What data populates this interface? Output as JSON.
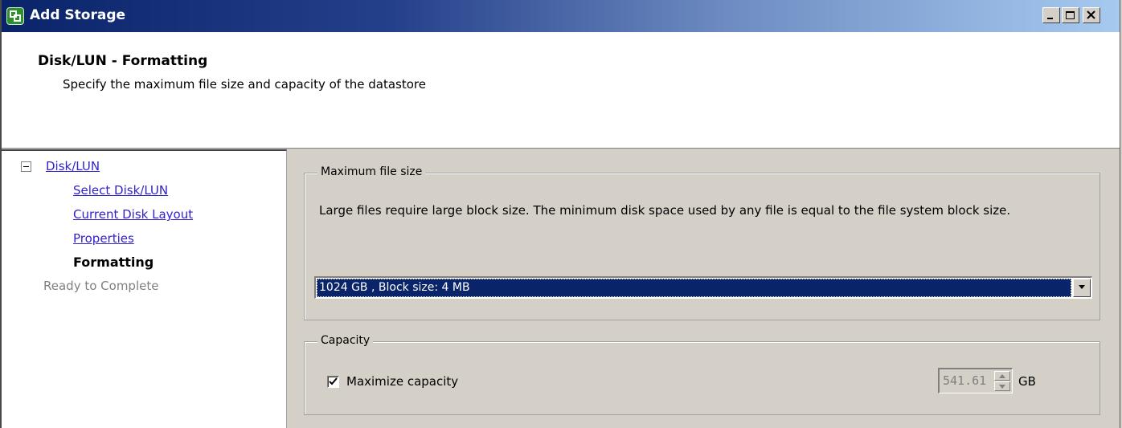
{
  "window": {
    "title": "Add Storage",
    "icon": "vmware-storage-icon",
    "controls": [
      "minimize-icon",
      "maximize-icon",
      "close-icon"
    ]
  },
  "header": {
    "title": "Disk/LUN - Formatting",
    "subtitle": "Specify the maximum file size and capacity of the datastore"
  },
  "nav": {
    "root": "Disk/LUN",
    "items": [
      {
        "label": "Select Disk/LUN",
        "state": "link"
      },
      {
        "label": "Current Disk Layout",
        "state": "link"
      },
      {
        "label": "Properties",
        "state": "link"
      },
      {
        "label": "Formatting",
        "state": "current"
      }
    ],
    "pending": "Ready to Complete"
  },
  "max_file_size": {
    "legend": "Maximum file size",
    "description": "Large files require large block size.  The minimum disk space used by any file is equal to the file system block size.",
    "selected": "1024 GB  ,  Block size: 4 MB"
  },
  "capacity": {
    "legend": "Capacity",
    "maximize_label": "Maximize capacity",
    "maximize_checked": true,
    "value": "541.61",
    "unit": "GB"
  },
  "colors": {
    "titlebar_start": "#0a246a",
    "titlebar_end": "#a6caf0",
    "selection": "#0a246a",
    "link": "#3322cc",
    "disabled": "#808080"
  }
}
